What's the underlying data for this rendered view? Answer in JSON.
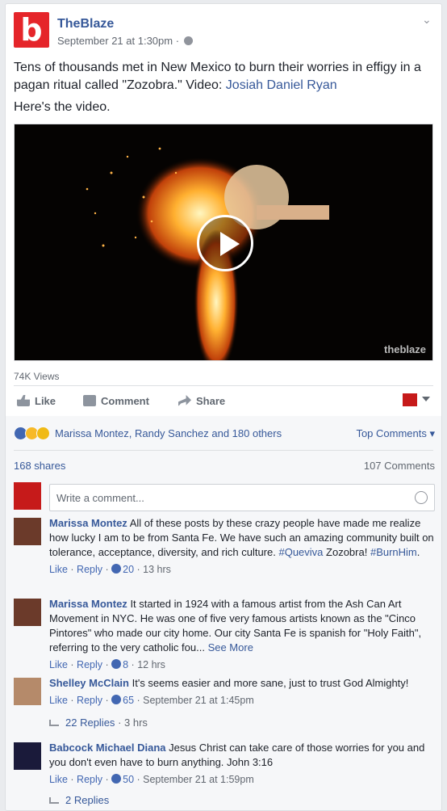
{
  "post": {
    "page_name": "TheBlaze",
    "logo_letter": "b",
    "timestamp": "September 21 at 1:30pm ·",
    "text": "Tens of thousands met in New Mexico to burn their worries in effigy in a pagan ritual called \"Zozobra.\" Video:",
    "text_link": "Josiah Daniel Ryan",
    "text2": "Here's the video.",
    "video_watermark": "theblaze",
    "views": "74K Views"
  },
  "actions": {
    "like": "Like",
    "comment": "Comment",
    "share": "Share"
  },
  "engagement": {
    "reactors": "Marissa Montez, Randy Sanchez and 180 others",
    "top_comments": "Top Comments ▾",
    "shares": "168 shares",
    "comments_count": "107 Comments",
    "write_placeholder": "Write a comment..."
  },
  "comments": [
    {
      "name": "Marissa Montez",
      "text": "All of these posts by these crazy people have made me realize how lucky I am to be from Santa Fe. We have such an amazing community built on tolerance, acceptance, diversity, and rich culture.",
      "tag1": "#Queviva",
      "mid": "Zozobra!",
      "tag2": "#BurnHim",
      "end": ".",
      "like": "Like",
      "reply": "Reply",
      "count": "20",
      "time": "13 hrs"
    },
    {
      "name": "Marissa Montez",
      "text": "It started in 1924 with a famous artist from the Ash Can Art Movement in NYC. He was one of five very famous artists known as the \"Cinco Pintores\" who made our city home. Our city Santa Fe is spanish for \"Holy Faith\", referring to the very catholic fou...",
      "see_more": "See More",
      "like": "Like",
      "reply": "Reply",
      "count": "8",
      "time": "12 hrs"
    },
    {
      "name": "Shelley McClain",
      "text": "It's seems easier and more sane, just to trust God Almighty!",
      "like": "Like",
      "reply": "Reply",
      "count": "65",
      "time": "September 21 at 1:45pm",
      "replies": "22 Replies",
      "replies_time": "· 3 hrs"
    },
    {
      "name": "Babcock Michael Diana",
      "text": "Jesus Christ can take care of those worries for you and you don't even have to burn anything. John 3:16",
      "like": "Like",
      "reply": "Reply",
      "count": "50",
      "time": "September 21 at 1:59pm",
      "replies": "2 Replies"
    }
  ],
  "colors": {
    "link": "#365899",
    "brand_red": "#e5252a",
    "bg": "#e9ebee"
  }
}
